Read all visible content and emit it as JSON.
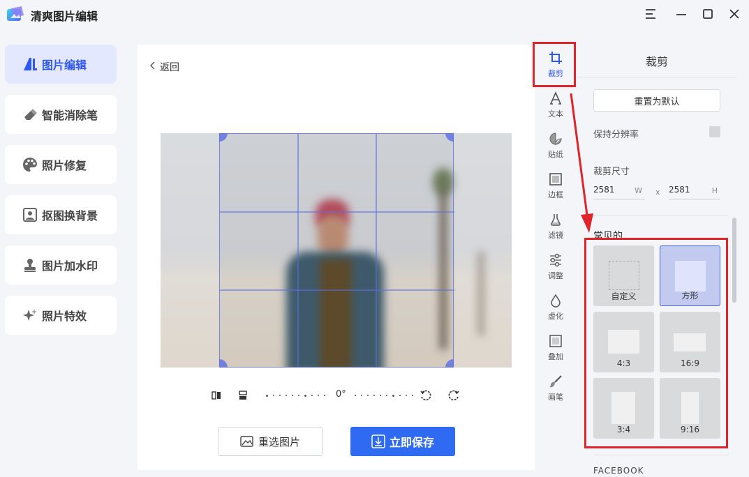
{
  "app": {
    "title": "清爽图片编辑",
    "window_controls": [
      "menu-icon",
      "minimize-icon",
      "maximize-icon",
      "close-icon"
    ]
  },
  "sidebar": {
    "items": [
      {
        "label": "图片编辑",
        "icon": "image-edit-icon",
        "active": true
      },
      {
        "label": "智能消除笔",
        "icon": "eraser-icon",
        "active": false
      },
      {
        "label": "照片修复",
        "icon": "palette-icon",
        "active": false
      },
      {
        "label": "抠图换背景",
        "icon": "portrait-cutout-icon",
        "active": false
      },
      {
        "label": "图片加水印",
        "icon": "stamp-icon",
        "active": false
      },
      {
        "label": "照片特效",
        "icon": "sparkle-icon",
        "active": false
      }
    ]
  },
  "editor": {
    "back_label": "返回",
    "rotation_angle": "0°",
    "reselect_label": "重选图片",
    "save_label": "立即保存"
  },
  "tool_rail": {
    "items": [
      {
        "label": "裁剪",
        "icon": "crop-icon",
        "active": true
      },
      {
        "label": "文本",
        "icon": "text-icon",
        "active": false
      },
      {
        "label": "贴纸",
        "icon": "sticker-icon",
        "active": false
      },
      {
        "label": "边框",
        "icon": "frame-icon",
        "active": false
      },
      {
        "label": "滤镜",
        "icon": "filter-icon",
        "active": false
      },
      {
        "label": "调整",
        "icon": "adjust-icon",
        "active": false
      },
      {
        "label": "虚化",
        "icon": "blur-icon",
        "active": false
      },
      {
        "label": "叠加",
        "icon": "overlay-icon",
        "active": false
      },
      {
        "label": "画笔",
        "icon": "brush-icon",
        "active": false
      }
    ]
  },
  "crop_panel": {
    "title": "裁剪",
    "reset_label": "重置为默认",
    "keep_resolution_label": "保持分辨率",
    "keep_resolution_checked": false,
    "size_label": "裁剪尺寸",
    "width_value": "2581",
    "width_unit": "W",
    "height_value": "2581",
    "height_unit": "H",
    "separator": "x",
    "common_label": "常见的",
    "ratios": [
      {
        "label": "自定义",
        "selected": false
      },
      {
        "label": "方形",
        "selected": true
      },
      {
        "label": "4:3",
        "selected": false
      },
      {
        "label": "16:9",
        "selected": false
      },
      {
        "label": "3:4",
        "selected": false
      },
      {
        "label": "9:16",
        "selected": false
      }
    ],
    "next_section_label": "FACEBOOK"
  },
  "colors": {
    "accent": "#2e57f5",
    "save_button": "#2e6bf2",
    "annotation_red": "#e0242a"
  }
}
